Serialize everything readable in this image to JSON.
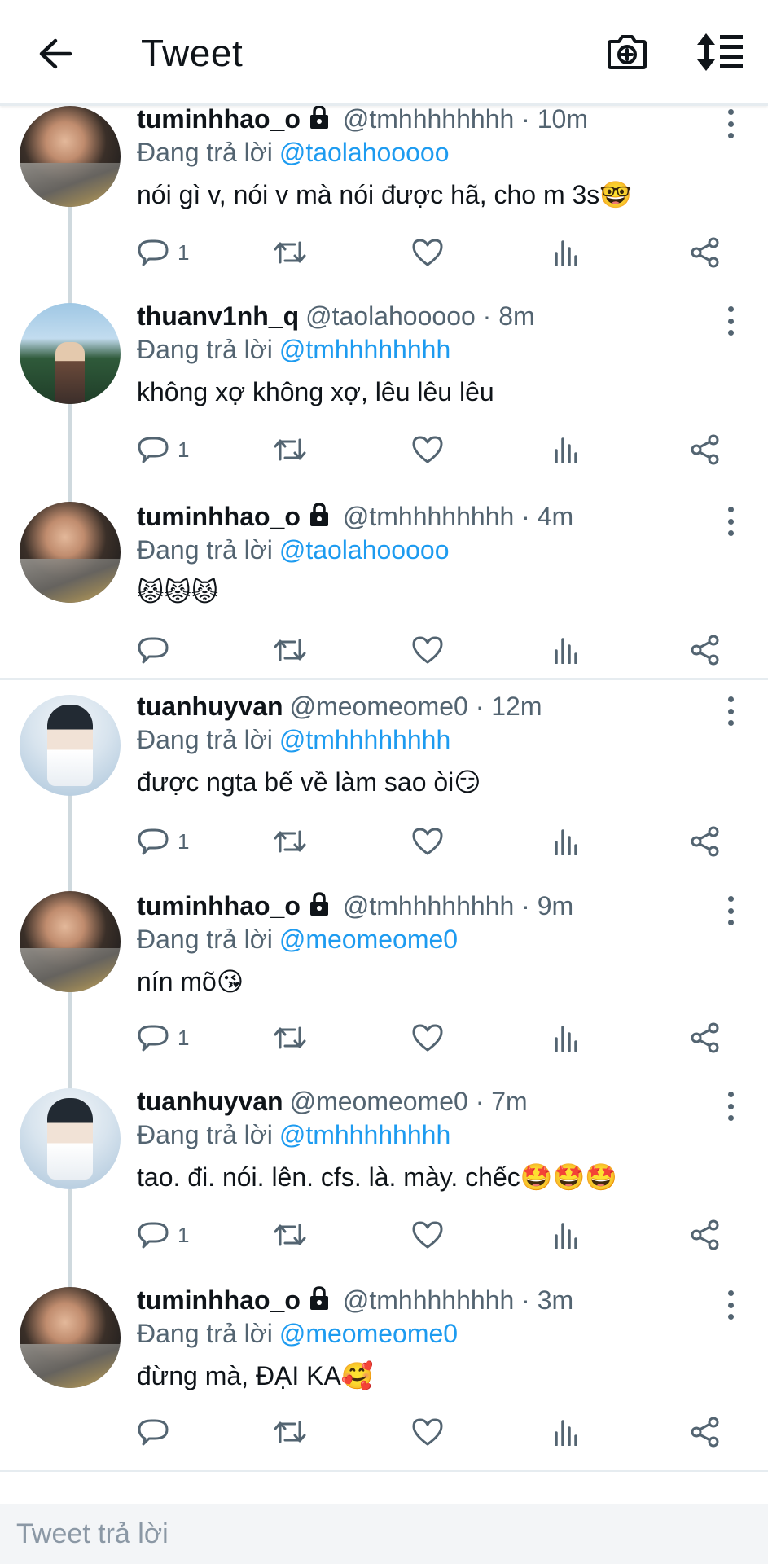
{
  "header": {
    "title": "Tweet",
    "back_icon": "arrow-left-icon",
    "camera_icon": "camera-plus-icon",
    "sort_icon": "sort-list-icon"
  },
  "colors": {
    "accent": "#1d9bf0",
    "secondary_text": "#536471",
    "primary_text": "#0f1419",
    "divider": "#e6ecf0"
  },
  "tweets": [
    {
      "name": "tuminhhao_o",
      "locked": true,
      "meta": "@tmhhhhhhhh · 10m",
      "replying_label": "Đang trả lời",
      "replying_to": "@taolahooooo",
      "text": "nói gì v, nói v mà nói được hã, cho m 3s🤓",
      "reply_count": "1"
    },
    {
      "name": "thuanv1nh_q",
      "locked": false,
      "meta": "@taolahooooo · 8m",
      "replying_label": "Đang trả lời",
      "replying_to": "@tmhhhhhhhh",
      "text": "không xợ không xợ, lêu  lêu lêu",
      "reply_count": "1"
    },
    {
      "name": "tuminhhao_o",
      "locked": true,
      "meta": "@tmhhhhhhhh · 4m",
      "replying_label": "Đang trả lời",
      "replying_to": "@taolahooooo",
      "text": "😾😾😾",
      "reply_count": ""
    },
    {
      "name": "tuanhuyvan",
      "locked": false,
      "meta": "@meomeome0 · 12m",
      "replying_label": "Đang trả lời",
      "replying_to": "@tmhhhhhhhh",
      "text": "được ngta bế về làm sao òi😏",
      "reply_count": "1"
    },
    {
      "name": "tuminhhao_o",
      "locked": true,
      "meta": "@tmhhhhhhhh · 9m",
      "replying_label": "Đang trả lời",
      "replying_to": "@meomeome0",
      "text": "nín mõ😘",
      "reply_count": "1"
    },
    {
      "name": "tuanhuyvan",
      "locked": false,
      "meta": "@meomeome0 · 7m",
      "replying_label": "Đang trả lời",
      "replying_to": "@tmhhhhhhhh",
      "text": "tao. đi. nói. lên. cfs. là. mày. chếc🤩🤩🤩",
      "reply_count": "1"
    },
    {
      "name": "tuminhhao_o",
      "locked": true,
      "meta": "@tmhhhhhhhh · 3m",
      "replying_label": "Đang trả lời",
      "replying_to": "@meomeome0",
      "text": "đừng mà, ĐẠI KA🥰",
      "reply_count": ""
    }
  ],
  "composer": {
    "placeholder": "Tweet trả lời"
  }
}
